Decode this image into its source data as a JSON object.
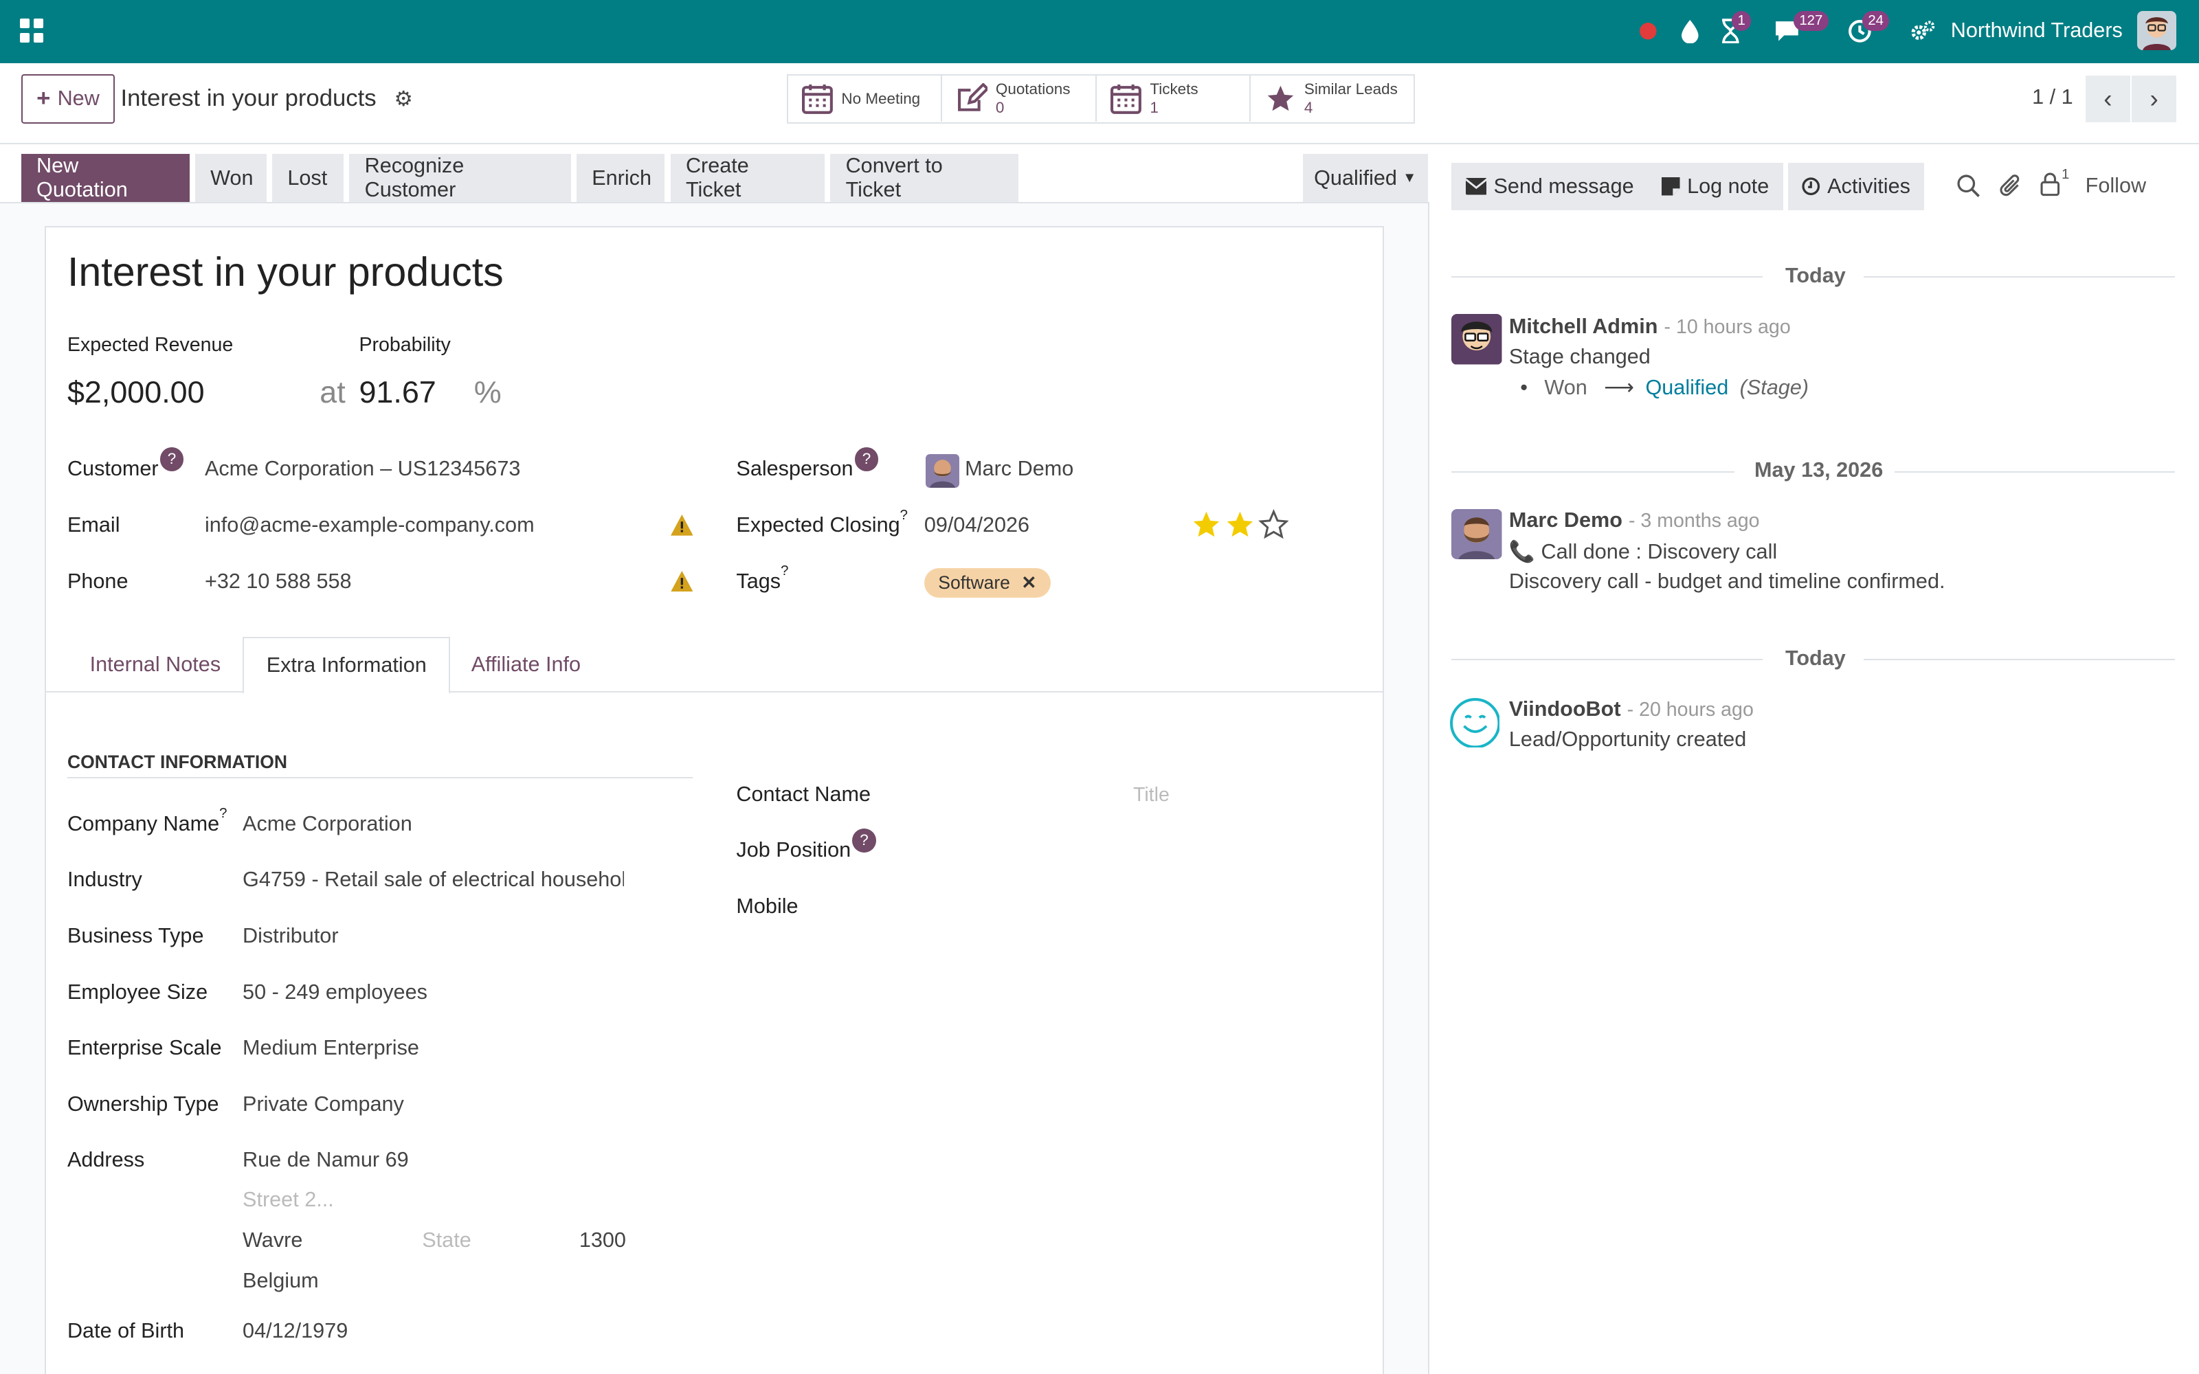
{
  "topbar": {
    "company": "Northwind Traders",
    "badges": {
      "activities": "1",
      "messages": "127",
      "timer": "24"
    },
    "brand_color": "#017e84"
  },
  "control_panel": {
    "new_label": "New",
    "breadcrumb_title": "Interest in your products",
    "smart_buttons": {
      "meeting": {
        "label": "No Meeting"
      },
      "quotations": {
        "label": "Quotations",
        "count": "0"
      },
      "tickets": {
        "label": "Tickets",
        "count": "1"
      },
      "similar": {
        "label": "Similar Leads",
        "count": "4"
      }
    },
    "pager": "1 / 1"
  },
  "statusbar": {
    "new_quotation": "New Quotation",
    "won": "Won",
    "lost": "Lost",
    "recognize": "Recognize Customer",
    "enrich": "Enrich",
    "create_ticket": "Create Ticket",
    "convert_ticket": "Convert to Ticket",
    "stage": "Qualified",
    "accent": "#714b67"
  },
  "lead": {
    "title": "Interest in your products",
    "expected_revenue_label": "Expected Revenue",
    "expected_revenue": "$2,000.00",
    "at": "at",
    "probability_label": "Probability",
    "probability": "91.67",
    "percent": "%",
    "customer_label": "Customer",
    "customer": "Acme Corporation – US12345673",
    "email_label": "Email",
    "email": "info@acme-example-company.com",
    "phone_label": "Phone",
    "phone": "+32 10 588 558",
    "salesperson_label": "Salesperson",
    "salesperson": "Marc Demo",
    "closing_label": "Expected Closing",
    "closing": "09/04/2026",
    "priority_stars": 2,
    "priority_max": 3,
    "tags_label": "Tags",
    "tag": "Software",
    "help_mark": "?"
  },
  "tabs": {
    "internal_notes": "Internal Notes",
    "extra_info": "Extra Information",
    "affiliate": "Affiliate Info"
  },
  "extra": {
    "section": "CONTACT INFORMATION",
    "company_name_label": "Company Name",
    "company_name": "Acme Corporation",
    "industry_label": "Industry",
    "industry": "G4759 - Retail sale of electrical househol",
    "business_type_label": "Business Type",
    "business_type": "Distributor",
    "employee_size_label": "Employee Size",
    "employee_size": "50 - 249 employees",
    "enterprise_scale_label": "Enterprise Scale",
    "enterprise_scale": "Medium Enterprise",
    "ownership_label": "Ownership Type",
    "ownership": "Private Company",
    "address_label": "Address",
    "street": "Rue de Namur 69",
    "street2_placeholder": "Street 2...",
    "city": "Wavre",
    "state_placeholder": "State",
    "zip": "1300",
    "country": "Belgium",
    "dob_label": "Date of Birth",
    "dob": "04/12/1979",
    "contact_name_label": "Contact Name",
    "title_placeholder": "Title",
    "job_position_label": "Job Position",
    "mobile_label": "Mobile"
  },
  "chatter": {
    "send_message": "Send message",
    "log_note": "Log note",
    "activities": "Activities",
    "followers_count": "1",
    "follow": "Follow",
    "groups": [
      {
        "date": "Today"
      },
      {
        "date": "May 13, 2026"
      },
      {
        "date": "Today"
      }
    ],
    "messages": [
      {
        "author": "Mitchell Admin",
        "ago": "- 10 hours ago",
        "body": "Stage changed",
        "from": "Won",
        "to": "Qualified",
        "field": "(Stage)"
      },
      {
        "author": "Marc Demo",
        "ago": "- 3 months ago",
        "body": "Call done : Discovery call",
        "detail": "Discovery call - budget and timeline confirmed."
      },
      {
        "author": "ViindooBot",
        "ago": "- 20 hours ago",
        "body": "Lead/Opportunity created"
      }
    ]
  }
}
